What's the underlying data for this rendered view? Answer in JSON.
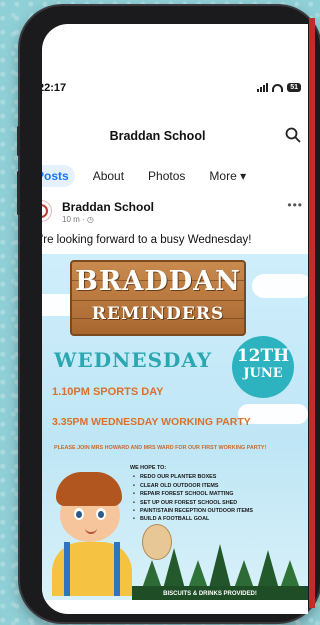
{
  "status_bar": {
    "time": "22:17",
    "battery": "51"
  },
  "navbar": {
    "back_icon": "chevron-left-icon",
    "title": "Braddan School",
    "search_icon": "search-icon"
  },
  "tabs": [
    {
      "label": "Posts",
      "active": true
    },
    {
      "label": "About",
      "active": false
    },
    {
      "label": "Photos",
      "active": false
    },
    {
      "label": "More ▾",
      "active": false
    }
  ],
  "post": {
    "author": "Braddan School",
    "meta": "10 m · ◷",
    "text": "We're looking forward to a busy Wednesday!",
    "more_icon": "more-horizontal-icon"
  },
  "poster": {
    "title_line1": "BRADDAN",
    "title_line2": "REMINDERS",
    "day": "WEDNESDAY",
    "date_day": "12TH",
    "date_month": "JUNE",
    "line1": "1.10PM SPORTS DAY",
    "line2": "3.35PM WEDNESDAY WORKING PARTY",
    "invite": "PLEASE JOIN MRS HOWARD AND MRS WARD FOR OUR FIRST WORKING PARTY!",
    "hope_heading": "WE HOPE TO:",
    "hope_items": [
      "REDO OUR PLANTER BOXES",
      "CLEAR OLD OUTDOOR ITEMS",
      "REPAIR FOREST SCHOOL MATTING",
      "SET UP OUR FOREST SCHOOL SHED",
      "PAINT/STAIN RECEPTION OUTDOOR ITEMS",
      "BUILD A FOOTBALL GOAL"
    ],
    "footer": "BISCUITS & DRINKS PROVIDED!"
  },
  "colors": {
    "accent": "#1877f2",
    "poster_orange": "#d9712b",
    "poster_teal": "#2aa7b0",
    "sign_wood": "#b0703a"
  }
}
